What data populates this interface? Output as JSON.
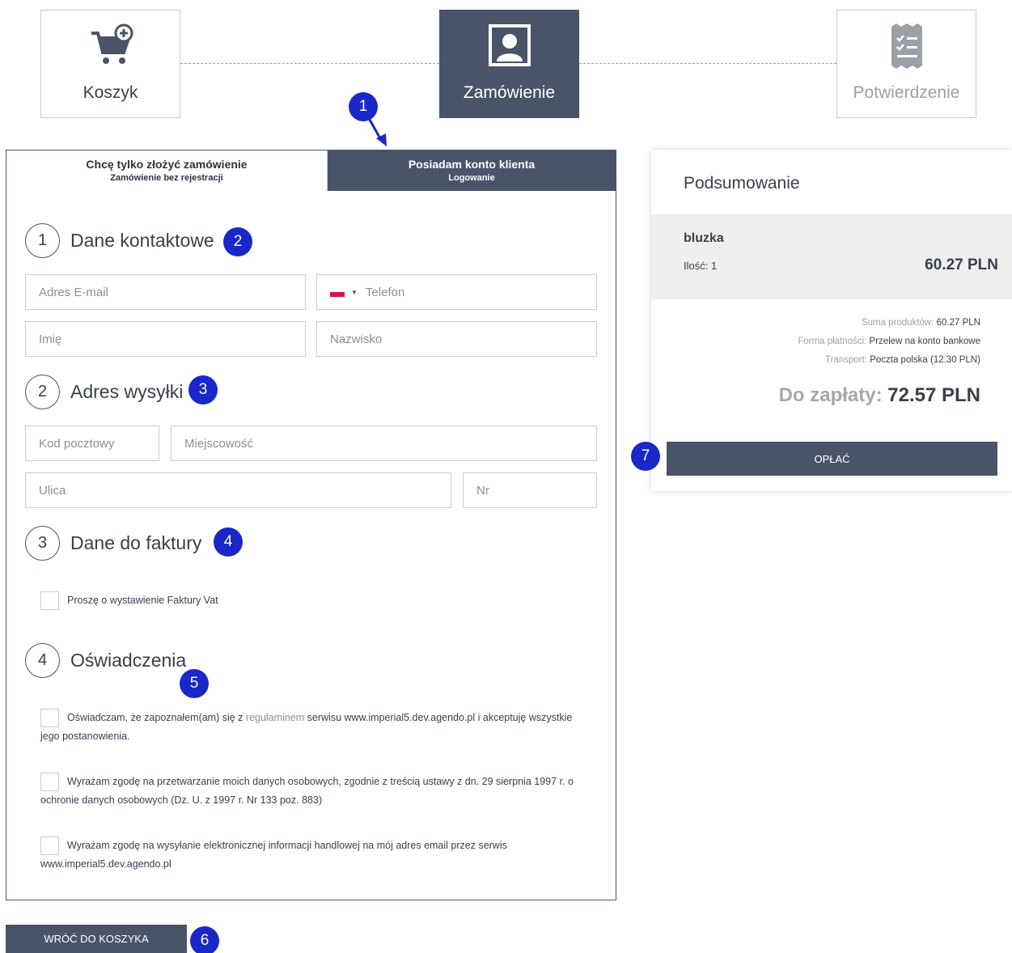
{
  "stepper": {
    "steps": [
      {
        "label": "Koszyk",
        "state": "previous"
      },
      {
        "label": "Zamówienie",
        "state": "active"
      },
      {
        "label": "Potwierdzenie",
        "state": "upcoming"
      }
    ]
  },
  "tabs": {
    "guest": {
      "title": "Chcę tylko złożyć zamówienie",
      "subtitle": "Zamówienie bez rejestracji"
    },
    "login": {
      "title": "Posiadam konto klienta",
      "subtitle": "Logowanie"
    }
  },
  "sections": {
    "contact": {
      "number": "1",
      "title": "Dane kontaktowe"
    },
    "shipping": {
      "number": "2",
      "title": "Adres wysyłki"
    },
    "invoice": {
      "number": "3",
      "title": "Dane do faktury"
    },
    "statements": {
      "number": "4",
      "title": "Oświadczenia"
    }
  },
  "fields": {
    "email": "Adres E-mail",
    "phone": "Telefon",
    "first_name": "Imię",
    "last_name": "Nazwisko",
    "postal_code": "Kod pocztowy",
    "city": "Miejscowość",
    "street": "Ulica",
    "number": "Nr"
  },
  "invoice_checkbox": "Proszę o wystawienie Faktury Vat",
  "statements": {
    "terms_before": "Oświadczam, że zapoznałem(am) się z ",
    "terms_link": "regulaminem",
    "terms_after": " serwisu www.imperial5.dev.agendo.pl i akceptuję wszystkie jego postanowienia.",
    "data_processing": "Wyrażam zgodę na przetwarzanie moich danych osobowych, zgodnie z treścią ustawy z dn. 29 sierpnia 1997 r. o ochronie danych osobowych (Dz. U. z 1997 r. Nr 133 poz. 883)",
    "marketing": "Wyrażam zgodę na wysyłanie elektronicznej informacji handlowej na mój adres email przez serwis www.imperial5.dev.agendo.pl"
  },
  "summary": {
    "title": "Podsumowanie",
    "item": {
      "name": "bluzka",
      "qty": "Ilość: 1",
      "price": "60.27 PLN"
    },
    "products_label": "Suma produktów:",
    "products_value": "60.27 PLN",
    "payment_label": "Forma płatności:",
    "payment_value": "Przelew na konto bankowe",
    "transport_label": "Transport:",
    "transport_value": "Poczta polska (12.30 PLN)",
    "total_label": "Do zapłaty:",
    "total_value": "72.57 PLN",
    "pay_button": "OPŁAĆ"
  },
  "back_button": "WRÓĆ DO KOSZYKA",
  "badges": [
    "1",
    "2",
    "3",
    "4",
    "5",
    "6",
    "7"
  ],
  "colors": {
    "primary": "#4a5468",
    "badge": "#1a27c9",
    "border": "#c9ccd1"
  }
}
